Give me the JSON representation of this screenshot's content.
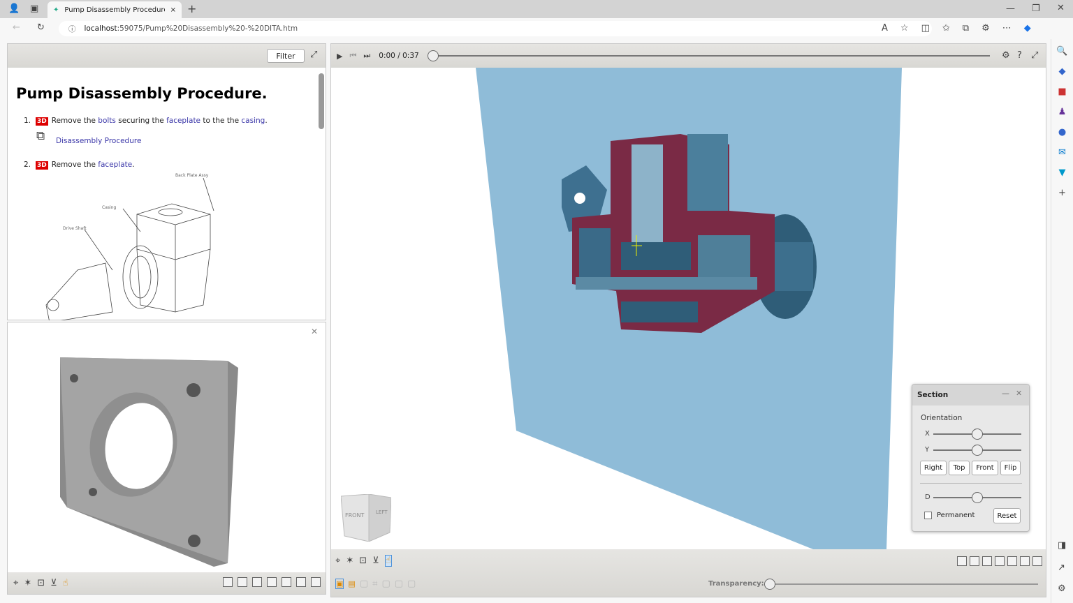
{
  "browser": {
    "tab_title": "Pump Disassembly Procedure. - C",
    "url_host": "localhost",
    "url_rest": ":59075/Pump%20Disassembly%20-%20DITA.htm",
    "new_tab": "+",
    "close_tab": "×"
  },
  "left": {
    "filter_label": "Filter",
    "title": "Pump Disassembly Procedure.",
    "steps": [
      {
        "num": "1.",
        "badge": "3D",
        "t1": "Remove the ",
        "l1": "bolts",
        "t2": " securing the ",
        "l2": "faceplate",
        "t3": " to the the ",
        "l3": "casing",
        "t4": "."
      },
      {
        "num": "2.",
        "badge": "3D",
        "t1": "Remove the ",
        "l1": "faceplate",
        "t2": "."
      }
    ],
    "sub_link": "Disassembly Procedure",
    "callouts": [
      "Back Plate Assy",
      "Casing",
      "Drive Shaft"
    ]
  },
  "player": {
    "time_current": "0:00",
    "time_sep": "/",
    "time_total": "0:37",
    "progress": 0
  },
  "section": {
    "title": "Section",
    "orientation_label": "Orientation",
    "x_label": "X",
    "y_label": "Y",
    "d_label": "D",
    "x_value": 0.5,
    "y_value": 0.5,
    "d_value": 0.5,
    "buttons": [
      "Right",
      "Top",
      "Front",
      "Flip"
    ],
    "permanent_label": "Permanent",
    "permanent_checked": false,
    "reset_label": "Reset"
  },
  "viewcube": {
    "front": "FRONT",
    "left": "LEFT"
  },
  "bottom": {
    "transparency_label": "Transparency:",
    "transparency_value": 0
  },
  "colors": {
    "plane": "#8fbcd8",
    "section_cut": "#7a2a45",
    "part": "#4b7f9c",
    "badge": "#dd0000"
  }
}
